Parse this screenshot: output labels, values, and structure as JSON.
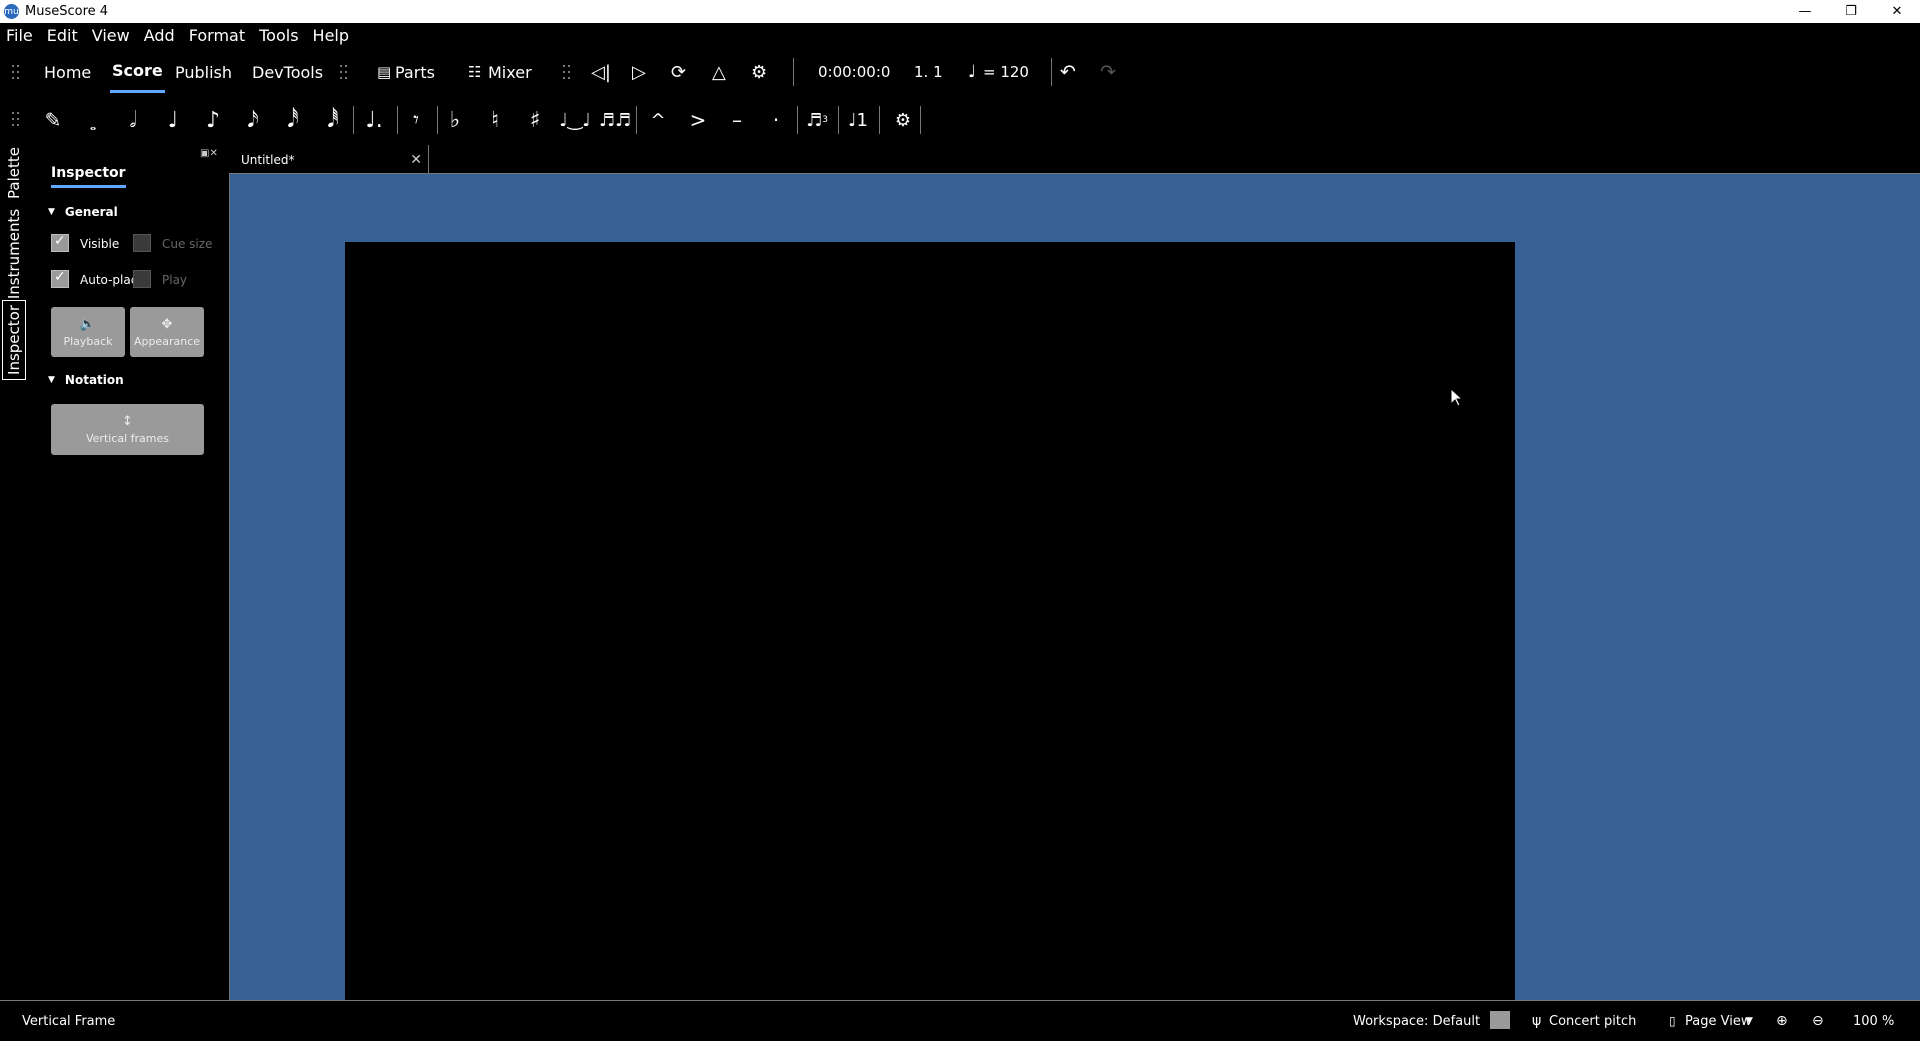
{
  "window": {
    "title": "MuseScore 4",
    "app_icon": "mu"
  },
  "menu": [
    "File",
    "Edit",
    "View",
    "Add",
    "Format",
    "Tools",
    "Help"
  ],
  "main_tabs": {
    "home": "Home",
    "score": "Score",
    "publish": "Publish",
    "devtools": "DevTools"
  },
  "toolbar": {
    "parts": "Parts",
    "mixer": "Mixer",
    "time": "0:00:00:0",
    "position": "1. 1",
    "tempo": "= 120"
  },
  "note_input": {
    "tuplet_number": "3"
  },
  "side_tabs": {
    "palette": "Palette",
    "instruments": "Instruments",
    "inspector": "Inspector"
  },
  "inspector": {
    "tab": "Inspector",
    "general": {
      "title": "General",
      "visible": "Visible",
      "visible_checked": true,
      "cue_size": "Cue size",
      "cue_size_checked": false,
      "auto_place": "Auto-place",
      "auto_place_checked": true,
      "play": "Play",
      "play_checked": false,
      "playback": "Playback",
      "appearance": "Appearance"
    },
    "notation": {
      "title": "Notation",
      "vertical_frames": "Vertical frames"
    }
  },
  "document": {
    "tab_title": "Untitled*"
  },
  "status": {
    "selection": "Vertical Frame",
    "workspace": "Workspace: Default",
    "concert_pitch": "Concert pitch",
    "view_mode": "Page View",
    "zoom": "100 %"
  },
  "colors": {
    "canvas": "#386196",
    "accent": "#5fa8ff",
    "button": "#9a9a9a"
  }
}
